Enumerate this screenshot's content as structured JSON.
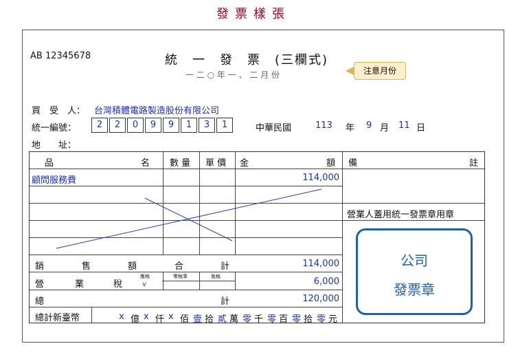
{
  "page_title": "發票樣張",
  "serial": "AB 12345678",
  "invoice_title": "統　一　發　票　(三欄式)",
  "period": "一 二 ○ 年 一 、 二 月 份",
  "callout": "注意月份",
  "buyer": {
    "label": "買　受　人：",
    "value": "台灣積體電路製造股份有限公司"
  },
  "tax_id": {
    "label": "統一編號：",
    "digits": [
      "2",
      "2",
      "0",
      "9",
      "9",
      "1",
      "3",
      "1"
    ]
  },
  "date": {
    "era": "中華民國",
    "year": "113",
    "year_unit": "年",
    "month": "9",
    "month_unit": "月",
    "day": "11",
    "day_unit": "日"
  },
  "address": {
    "label": "地　　址："
  },
  "table": {
    "headers": {
      "item": "品",
      "name": "名",
      "qty": "數 量",
      "unit_price": "單 價",
      "amount_left": "金",
      "amount_right": "額",
      "remark_left": "備",
      "remark_right": "註"
    },
    "rows": [
      {
        "item": "顧問服務費",
        "amount": "114,000"
      }
    ],
    "seal_note": "營業人蓋用統一發票章用章",
    "sales": {
      "c1": "銷",
      "c2": "售",
      "c3": "額",
      "c4": "合",
      "c5": "計",
      "value": "114,000"
    },
    "tax": {
      "c1": "營",
      "c2": "業",
      "c3": "稅",
      "taxable": "應稅",
      "zero_rate": "零稅率",
      "exempt": "免稅",
      "mark": "v",
      "value": "6,000"
    },
    "total": {
      "c1": "總",
      "c2": "計",
      "value": "120,000"
    },
    "grand": {
      "label": "總計新臺幣",
      "digits": [
        {
          "v": "x",
          "u": "億"
        },
        {
          "v": "x",
          "u": "仟"
        },
        {
          "v": "x",
          "u": "佰"
        },
        {
          "v": "壹",
          "u": "拾"
        },
        {
          "v": "貳",
          "u": "萬"
        },
        {
          "v": "零",
          "u": "千"
        },
        {
          "v": "零",
          "u": "百"
        },
        {
          "v": "零",
          "u": "拾"
        },
        {
          "v": "零",
          "u": "元"
        }
      ]
    }
  },
  "stamp": {
    "line1": "公司",
    "line2": "發票章"
  },
  "colors": {
    "title_red": "#b0001e",
    "fill_blue": "#1b2fc8",
    "stamp_blue": "#1d5fb0",
    "callout_bg": "#fdf0c8"
  }
}
